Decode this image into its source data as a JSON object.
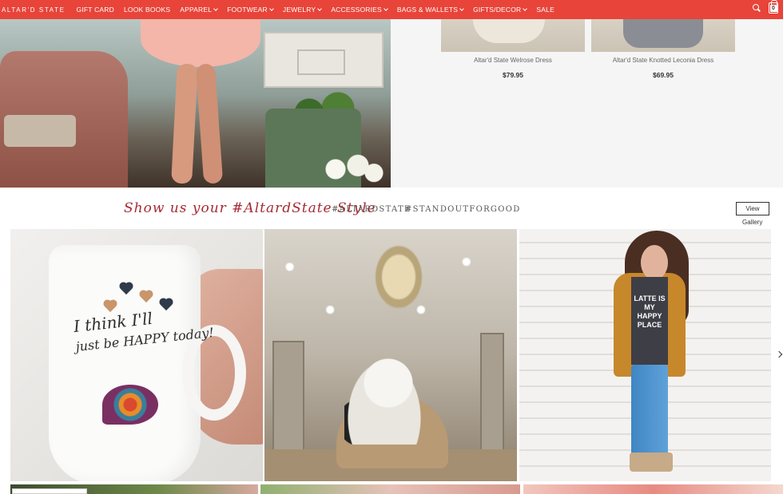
{
  "nav": {
    "logo": "ALTAR'D STATE",
    "items": [
      {
        "label": "GIFT CARD",
        "dropdown": false
      },
      {
        "label": "LOOK BOOKS",
        "dropdown": false
      },
      {
        "label": "APPAREL",
        "dropdown": true
      },
      {
        "label": "FOOTWEAR",
        "dropdown": true
      },
      {
        "label": "JEWELRY",
        "dropdown": true
      },
      {
        "label": "ACCESSORIES",
        "dropdown": true
      },
      {
        "label": "BAGS & WALLETS",
        "dropdown": true
      },
      {
        "label": "GIFTS/DECOR",
        "dropdown": true
      },
      {
        "label": "SALE",
        "dropdown": false
      }
    ],
    "cart_count": "0",
    "accent_color": "#e8443a"
  },
  "products": [
    {
      "name": "Altar'd State Welrose Dress",
      "price": "$79.95"
    },
    {
      "name": "Altar'd State Knotted Leconia Dress",
      "price": "$69.95"
    }
  ],
  "social": {
    "title": "Show us your #AltardState Style",
    "tags": [
      "#ALTARDSTATE",
      "#STANDOUTFORGOOD"
    ],
    "view_button": "View",
    "gallery_label": "Gallery",
    "title_color": "#a52a34"
  },
  "gallery": {
    "mug_text_line1": "I think I'll",
    "mug_text_line2": "just be HAPPY today!",
    "tee_text": "LATTE IS MY HAPPY PLACE"
  }
}
